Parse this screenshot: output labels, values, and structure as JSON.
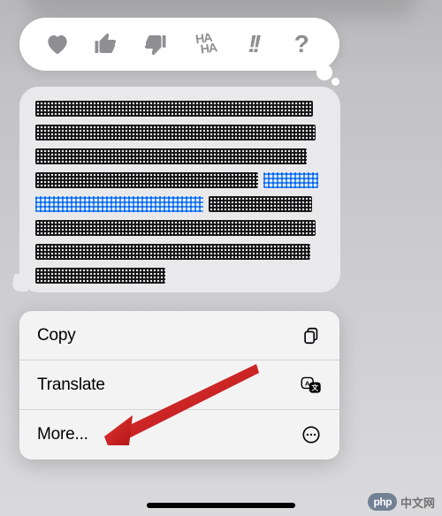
{
  "reactions": {
    "heart": "heart",
    "thumbs_up": "thumbs-up",
    "thumbs_down": "thumbs-down",
    "haha_top": "HA",
    "haha_bottom": "HA",
    "exclaim": "!!",
    "question": "?"
  },
  "message": {
    "content_redacted": true
  },
  "context_menu": {
    "items": [
      {
        "label": "Copy",
        "icon": "copy-icon"
      },
      {
        "label": "Translate",
        "icon": "translate-icon"
      },
      {
        "label": "More...",
        "icon": "more-icon"
      }
    ]
  },
  "watermark": {
    "badge": "php",
    "text": "中文网"
  }
}
